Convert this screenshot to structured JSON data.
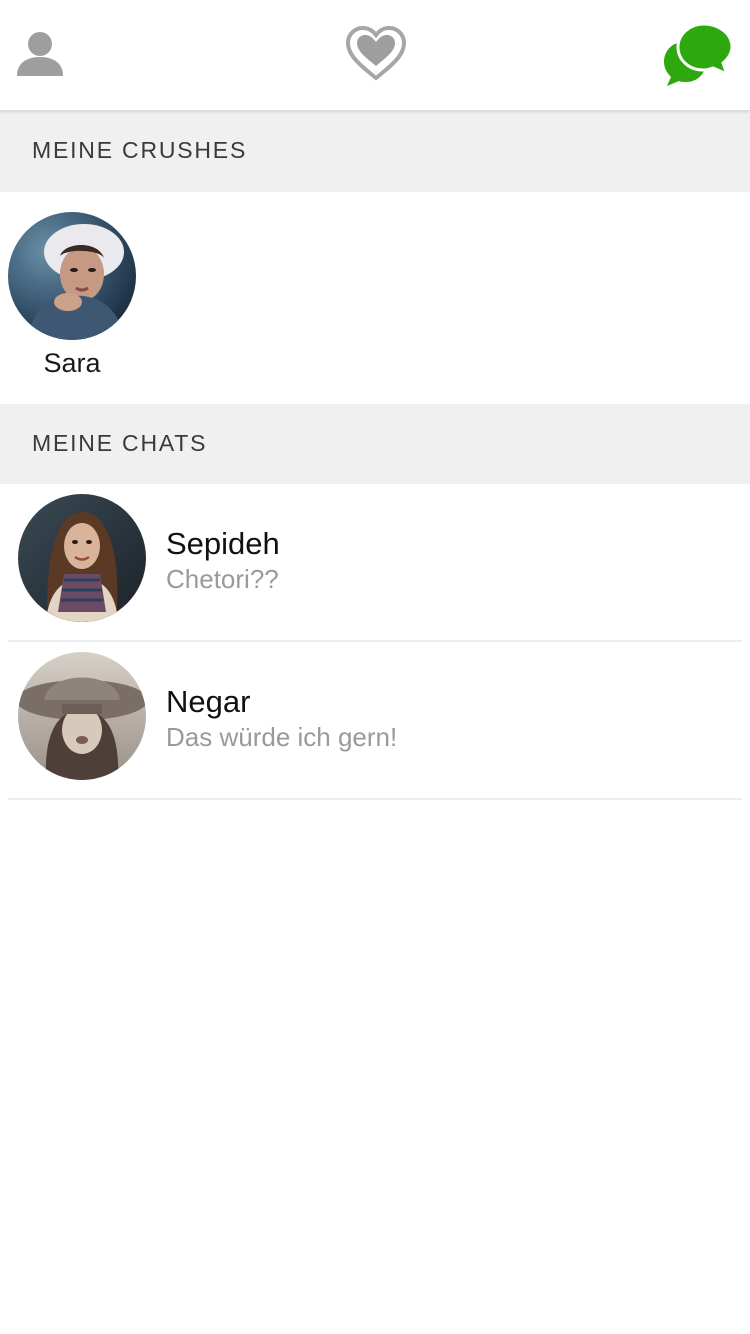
{
  "topbar": {
    "profile_icon": "person-icon",
    "logo_icon": "double-heart-icon",
    "chat_icon": "chat-bubbles-icon",
    "icon_color": "#9e9e9e",
    "accent_color": "#2ea80f"
  },
  "crushes": {
    "title": "MEINE CRUSHES",
    "items": [
      {
        "name": "Sara"
      }
    ]
  },
  "chats": {
    "title": "MEINE CHATS",
    "items": [
      {
        "name": "Sepideh",
        "last_message": "Chetori??"
      },
      {
        "name": "Negar",
        "last_message": "Das würde ich gern!"
      }
    ]
  }
}
